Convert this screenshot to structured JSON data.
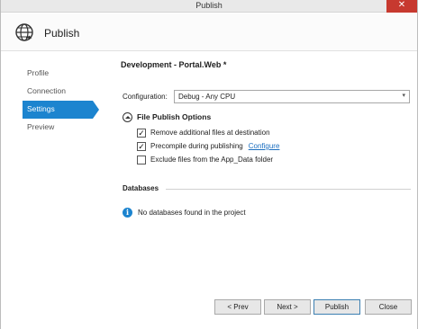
{
  "window": {
    "title": "Publish",
    "close_glyph": "✕"
  },
  "header": {
    "icon": "globe-icon",
    "title": "Publish"
  },
  "nav": {
    "items": [
      {
        "label": "Profile",
        "active": false
      },
      {
        "label": "Connection",
        "active": false
      },
      {
        "label": "Settings",
        "active": true
      },
      {
        "label": "Preview",
        "active": false
      }
    ]
  },
  "settings": {
    "profile_name": "Development - Portal.Web *",
    "configuration": {
      "label": "Configuration:",
      "value": "Debug - Any CPU"
    },
    "file_publish": {
      "title": "File Publish Options",
      "options": [
        {
          "label": "Remove additional files at destination",
          "checked": true
        },
        {
          "label": "Precompile during publishing",
          "checked": true,
          "link": "Configure"
        },
        {
          "label": "Exclude files from the App_Data folder",
          "checked": false
        }
      ]
    },
    "databases": {
      "title": "Databases",
      "message": "No databases found in the project"
    }
  },
  "footer": {
    "prev": "< Prev",
    "next": "Next >",
    "publish": "Publish",
    "close": "Close"
  },
  "colors": {
    "accent": "#1c84cf",
    "close_button": "#c7392f"
  }
}
